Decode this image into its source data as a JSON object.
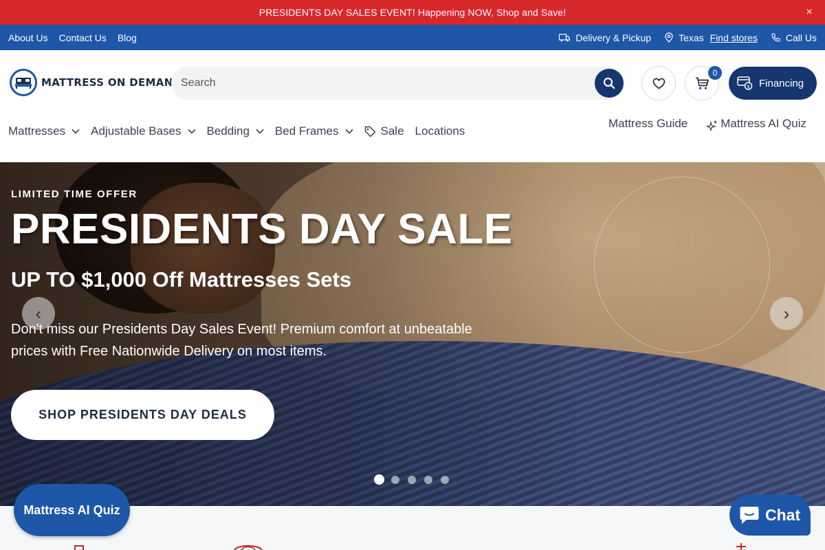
{
  "announcement": {
    "text": "PRESIDENTS DAY SALES EVENT! Happening NOW, Shop and Save!",
    "close": "×"
  },
  "utility": {
    "links": [
      "About Us",
      "Contact Us",
      "Blog"
    ],
    "delivery": "Delivery & Pickup",
    "location": "Texas",
    "find_stores": "Find stores",
    "call": "Call Us"
  },
  "header": {
    "logo_text": "MATTRESS ON DEMAND",
    "search_placeholder": "Search",
    "cart_count": "0",
    "financing": "Financing"
  },
  "nav": {
    "items": [
      "Mattresses",
      "Adjustable Bases",
      "Bedding",
      "Bed Frames",
      "Sale",
      "Locations"
    ],
    "right": [
      "Mattress Guide",
      "Mattress AI Quiz"
    ]
  },
  "hero": {
    "eyebrow": "LIMITED TIME OFFER",
    "title": "PRESIDENTS DAY SALE",
    "subtitle": "UP TO $1,000 Off Mattresses Sets",
    "body": "Don't miss our Presidents Day Sales Event! Premium comfort at unbeatable prices with Free Nationwide Delivery on most items.",
    "cta": "SHOP PRESIDENTS DAY DEALS",
    "prev": "‹",
    "next": "›",
    "slide_count": 5,
    "active_slide": 1
  },
  "floating": {
    "quiz": "Mattress AI Quiz",
    "chat": "Chat"
  },
  "colors": {
    "announce": "#d8282b",
    "utility": "#1e56a8",
    "navy": "#15366e"
  }
}
